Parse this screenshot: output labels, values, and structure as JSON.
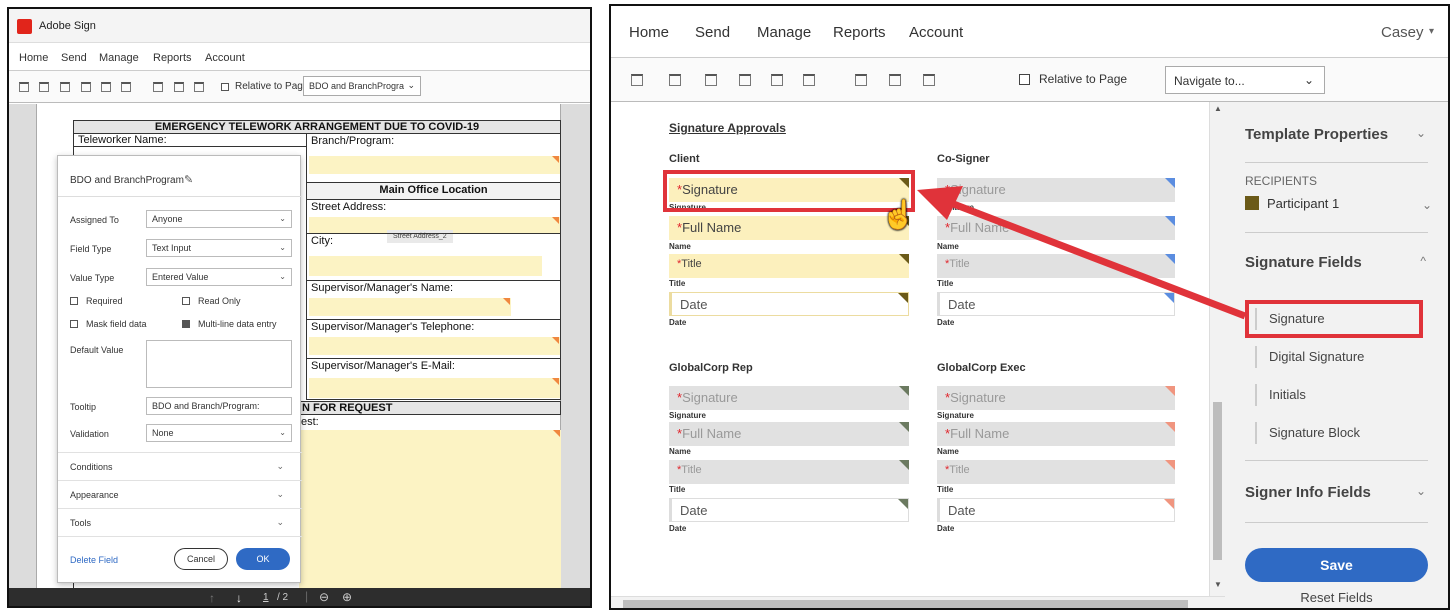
{
  "left": {
    "app_title": "Adobe Sign",
    "menu": [
      "Home",
      "Send",
      "Manage",
      "Reports",
      "Account"
    ],
    "toolbar": {
      "relative_label": "Relative to Page",
      "navigate_value": "BDO and BranchProgra"
    },
    "doc": {
      "heading": "EMERGENCY TELEWORK ARRANGEMENT DUE TO COVID-19",
      "teleworker": "Teleworker Name:",
      "branch": "Branch/Program:",
      "main_office": "Main Office Location",
      "street": "Street Address:",
      "street_tag": "Street Address_2",
      "city": "City:",
      "sup_name": "Supervisor/Manager's Name:",
      "sup_phone": "Supervisor/Manager's Telephone:",
      "sup_email": "Supervisor/Manager's E-Mail:",
      "reason": "N FOR REQUEST",
      "reason2": "est:"
    },
    "props": {
      "field_name": "BDO and BranchProgram",
      "assigned_to_label": "Assigned To",
      "assigned_to": "Anyone",
      "field_type_label": "Field Type",
      "field_type": "Text Input",
      "value_type_label": "Value Type",
      "value_type": "Entered Value",
      "required": "Required",
      "read_only": "Read Only",
      "mask": "Mask field data",
      "multiline": "Multi-line data entry",
      "default_value": "Default Value",
      "tooltip_label": "Tooltip",
      "tooltip": "BDO and Branch/Program:",
      "validation_label": "Validation",
      "validation": "None",
      "conditions": "Conditions",
      "appearance": "Appearance",
      "tools": "Tools",
      "delete": "Delete Field",
      "cancel": "Cancel",
      "ok": "OK"
    },
    "pager": {
      "page": "1",
      "total": "/ 2"
    }
  },
  "right": {
    "menu": [
      "Home",
      "Send",
      "Manage",
      "Reports",
      "Account"
    ],
    "user": "Casey",
    "toolbar": {
      "relative_label": "Relative to Page",
      "navigate": "Navigate to..."
    },
    "form": {
      "section": "Signature Approvals",
      "client": "Client",
      "cosigner": "Co-Signer",
      "globalrep": "GlobalCorp Rep",
      "globalexec": "GlobalCorp Exec",
      "signature": "Signature",
      "full_name": "Full Name",
      "title": "Title",
      "date": "Date",
      "lab_signature": "Signature",
      "lab_name": "Name",
      "lab_title": "Title",
      "lab_date": "Date",
      "star": "*"
    },
    "side": {
      "template_props": "Template Properties",
      "recipients": "RECIPIENTS",
      "participant": "Participant 1",
      "sig_fields": "Signature Fields",
      "items": [
        "Signature",
        "Digital Signature",
        "Initials",
        "Signature Block"
      ],
      "signer_info": "Signer Info Fields",
      "save": "Save",
      "reset": "Reset Fields"
    },
    "colors": {
      "accent": "#2f6ac4",
      "highlight": "#e0333a",
      "field_yellow": "#fcf0bd"
    }
  }
}
